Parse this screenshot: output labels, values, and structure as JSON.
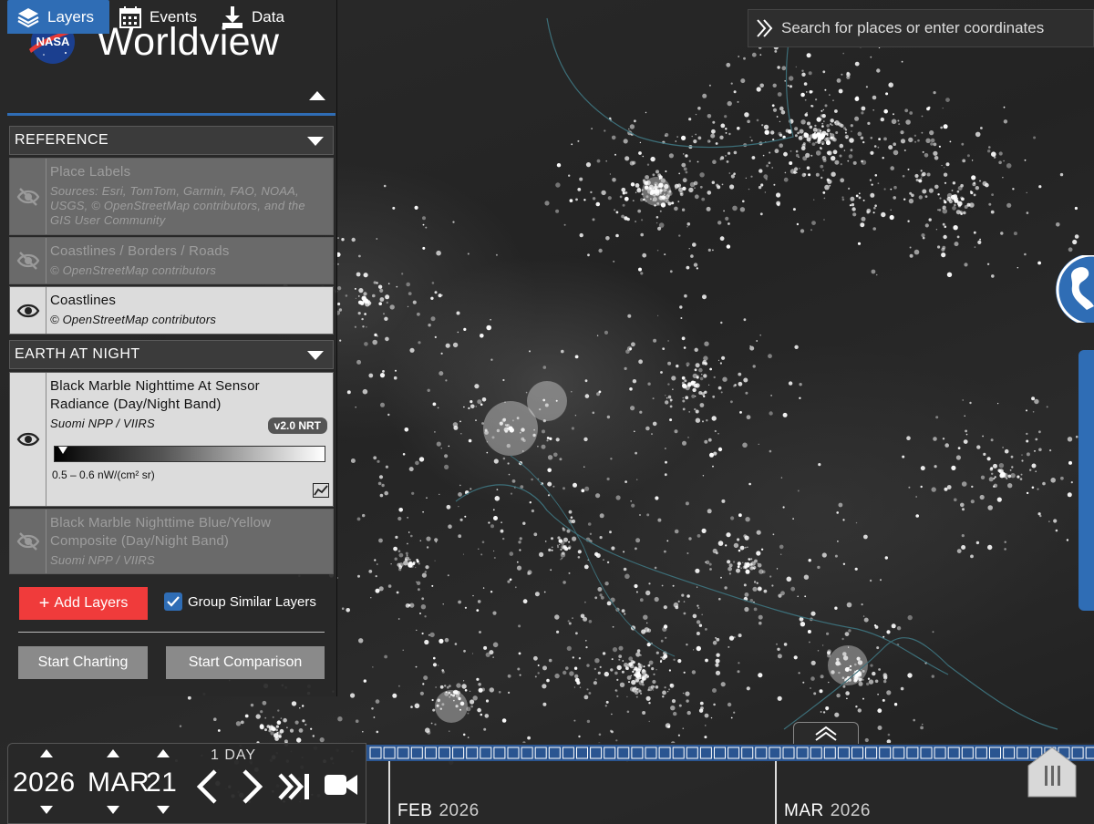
{
  "app": {
    "title": "Worldview"
  },
  "tabs": {
    "layers": "Layers",
    "events": "Events",
    "data": "Data"
  },
  "groups": [
    {
      "title": "REFERENCE",
      "layers": [
        {
          "name": "Place Labels",
          "source": "Sources: Esri, TomTom, Garmin, FAO, NOAA, USGS, © OpenStreetMap contributors, and the GIS User Community",
          "visible": false
        },
        {
          "name": "Coastlines / Borders / Roads",
          "source": "© OpenStreetMap contributors",
          "visible": false
        },
        {
          "name": "Coastlines",
          "source": "© OpenStreetMap contributors",
          "visible": true
        }
      ]
    },
    {
      "title": "EARTH AT NIGHT",
      "layers": [
        {
          "name": "Black Marble Nighttime At Sensor Radiance (Day/Night Band)",
          "source": "Suomi NPP / VIIRS",
          "badge": "v2.0 NRT",
          "legend_range": "0.5 – 0.6 nW/(cm² sr)",
          "visible": true
        },
        {
          "name": "Black Marble Nighttime Blue/Yellow Composite (Day/Night Band)",
          "source": "Suomi NPP / VIIRS",
          "visible": false
        }
      ]
    }
  ],
  "actions": {
    "add_layers": "Add Layers",
    "group_similar": "Group Similar Layers",
    "group_similar_checked": true,
    "start_charting": "Start Charting",
    "start_comparison": "Start Comparison"
  },
  "search": {
    "placeholder": "Search for places or enter coordinates"
  },
  "date": {
    "year": "2026",
    "month": "MAR",
    "day": "21",
    "interval": "1 DAY"
  },
  "timeline": {
    "months": [
      {
        "month": "FEB",
        "year": "2026"
      },
      {
        "month": "MAR",
        "year": "2026"
      }
    ]
  },
  "colors": {
    "accent": "#2f6db5",
    "add_button": "#f03b3b"
  },
  "icons": [
    "layers-icon",
    "calendar-icon",
    "download-icon",
    "eye-icon",
    "eye-slash-icon",
    "chevron-down-icon",
    "chart-icon",
    "check-icon",
    "search-chevron-icon",
    "globe-icon",
    "video-camera-icon"
  ]
}
